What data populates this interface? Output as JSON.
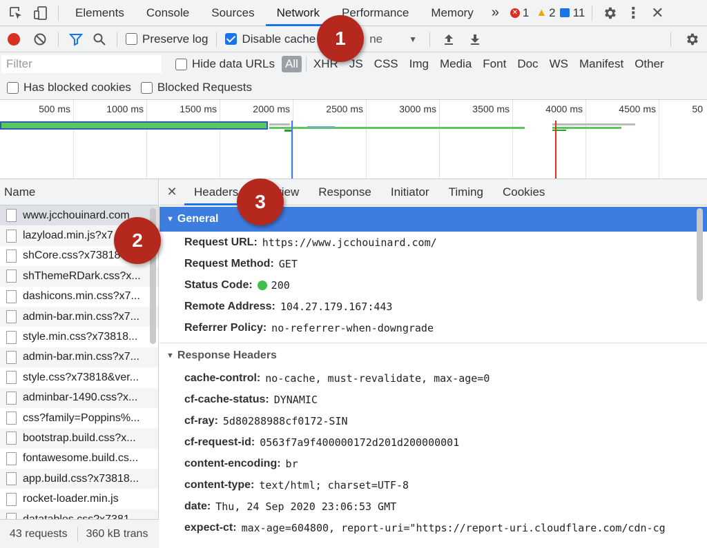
{
  "topbar": {
    "tabs": [
      "Elements",
      "Console",
      "Sources",
      "Network",
      "Performance",
      "Memory"
    ],
    "active_tab": "Network",
    "more": "»",
    "errors": "1",
    "warnings": "2",
    "messages": "11"
  },
  "toolbar": {
    "preserve_log": "Preserve log",
    "disable_cache": "Disable cache",
    "throttle": "ne"
  },
  "filter": {
    "placeholder": "Filter",
    "hide_data_urls": "Hide data URLs",
    "types": [
      "All",
      "XHR",
      "JS",
      "CSS",
      "Img",
      "Media",
      "Font",
      "Doc",
      "WS",
      "Manifest",
      "Other"
    ],
    "has_blocked_cookies": "Has blocked cookies",
    "blocked_requests": "Blocked Requests"
  },
  "timeline": {
    "ticks": [
      "500 ms",
      "1000 ms",
      "1500 ms",
      "2000 ms",
      "2500 ms",
      "3000 ms",
      "3500 ms",
      "4000 ms",
      "4500 ms",
      "50"
    ]
  },
  "names": {
    "header": "Name",
    "rows": [
      "www.jcchouinard.com",
      "lazyload.min.js?x7",
      "shCore.css?x73818",
      "shThemeRDark.css?x...",
      "dashicons.min.css?x7...",
      "admin-bar.min.css?x7...",
      "style.min.css?x73818...",
      "admin-bar.min.css?x7...",
      "style.css?x73818&ver...",
      "adminbar-1490.css?x...",
      "css?family=Poppins%...",
      "bootstrap.build.css?x...",
      "fontawesome.build.cs...",
      "app.build.css?x73818...",
      "rocket-loader.min.js",
      "datatables.css?x7381"
    ],
    "requests": "43 requests",
    "transferred": "360 kB trans"
  },
  "details": {
    "tabs": [
      "Headers",
      "Preview",
      "Response",
      "Initiator",
      "Timing",
      "Cookies"
    ],
    "tab_preview_visible": "view",
    "active_tab": "Headers",
    "general_title": "General",
    "general": [
      {
        "k": "Request URL:",
        "v": "https://www.jcchouinard.com/"
      },
      {
        "k": "Request Method:",
        "v": "GET"
      },
      {
        "k": "Status Code:",
        "v": "200"
      },
      {
        "k": "Remote Address:",
        "v": "104.27.179.167:443"
      },
      {
        "k": "Referrer Policy:",
        "v": "no-referrer-when-downgrade"
      }
    ],
    "response_title": "Response Headers",
    "response": [
      {
        "k": "cache-control:",
        "v": "no-cache, must-revalidate, max-age=0"
      },
      {
        "k": "cf-cache-status:",
        "v": "DYNAMIC"
      },
      {
        "k": "cf-ray:",
        "v": "5d80288988cf0172-SIN"
      },
      {
        "k": "cf-request-id:",
        "v": "0563f7a9f400000172d201d200000001"
      },
      {
        "k": "content-encoding:",
        "v": "br"
      },
      {
        "k": "content-type:",
        "v": "text/html; charset=UTF-8"
      },
      {
        "k": "date:",
        "v": "Thu, 24 Sep 2020 23:06:53 GMT"
      },
      {
        "k": "expect-ct:",
        "v": "max-age=604800, report-uri=\"https://report-uri.cloudflare.com/cdn-cg"
      }
    ]
  },
  "badges": [
    "1",
    "2",
    "3"
  ],
  "colors": {
    "accent": "#1a73e8",
    "general_header": "#3e7de0",
    "record": "#d93025",
    "badge": "#b5281e",
    "status_ok": "#3fbf4a"
  }
}
